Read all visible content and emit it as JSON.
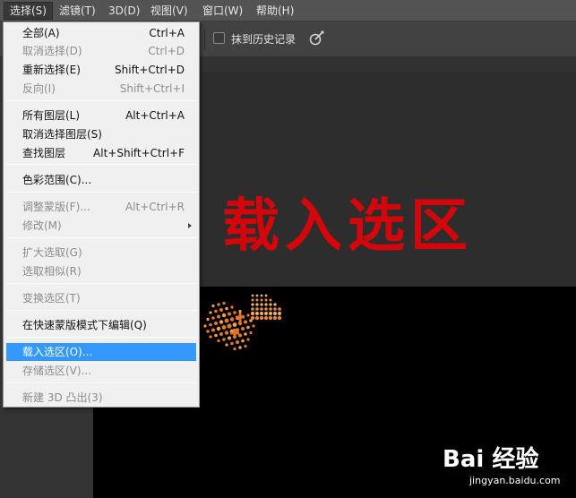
{
  "menubar": {
    "items": [
      {
        "label": "选择(S)",
        "active": true
      },
      {
        "label": "滤镜(T)"
      },
      {
        "label": "3D(D)"
      },
      {
        "label": "视图(V)"
      },
      {
        "label": "窗口(W)"
      },
      {
        "label": "帮助(H)"
      }
    ]
  },
  "options": {
    "history_checkbox_label": "抹到历史记录",
    "history_checkbox_checked": false,
    "brush_icon": "airbrush-icon"
  },
  "canvas": {
    "title_text": "载入选区",
    "title_color": "#d4060b"
  },
  "menu": {
    "items": [
      {
        "label": "全部(A)",
        "shortcut": "Ctrl+A",
        "disabled": false
      },
      {
        "label": "取消选择(D)",
        "shortcut": "Ctrl+D",
        "disabled": true
      },
      {
        "label": "重新选择(E)",
        "shortcut": "Shift+Ctrl+D",
        "disabled": false
      },
      {
        "label": "反向(I)",
        "shortcut": "Shift+Ctrl+I",
        "disabled": true
      },
      {
        "label": "所有图层(L)",
        "shortcut": "Alt+Ctrl+A",
        "disabled": false
      },
      {
        "label": "取消选择图层(S)",
        "shortcut": "",
        "disabled": false
      },
      {
        "label": "查找图层",
        "shortcut": "Alt+Shift+Ctrl+F",
        "disabled": false
      },
      {
        "label": "色彩范围(C)...",
        "shortcut": "",
        "disabled": false
      },
      {
        "label": "调整蒙版(F)...",
        "shortcut": "Alt+Ctrl+R",
        "disabled": true
      },
      {
        "label": "修改(M)",
        "shortcut": "",
        "disabled": true,
        "submenu": true
      },
      {
        "label": "扩大选取(G)",
        "shortcut": "",
        "disabled": true
      },
      {
        "label": "选取相似(R)",
        "shortcut": "",
        "disabled": true
      },
      {
        "label": "变换选区(T)",
        "shortcut": "",
        "disabled": true
      },
      {
        "label": "在快速蒙版模式下编辑(Q)",
        "shortcut": "",
        "disabled": false
      },
      {
        "label": "载入选区(O)...",
        "shortcut": "",
        "disabled": false,
        "highlighted": true
      },
      {
        "label": "存储选区(V)...",
        "shortcut": "",
        "disabled": true
      },
      {
        "label": "新建 3D 凸出(3)",
        "shortcut": "",
        "disabled": true
      }
    ]
  },
  "watermark": {
    "logo": "Bai 经验",
    "url": "jingyan.baidu.com"
  },
  "accent_color": "#3399ff"
}
